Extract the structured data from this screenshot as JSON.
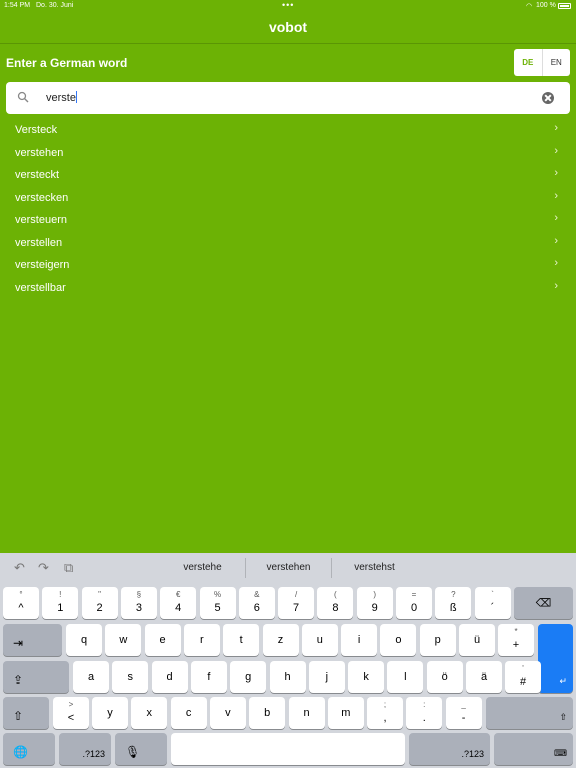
{
  "status": {
    "time": "1:54 PM",
    "date": "Do. 30. Juni",
    "dots": "•••",
    "wifi": "◠",
    "battery": "100 %"
  },
  "nav": {
    "title": "vobot"
  },
  "prompt": "Enter a German word",
  "language": {
    "options": [
      "DE",
      "EN"
    ],
    "selected": "DE"
  },
  "search": {
    "value": "verste"
  },
  "results": [
    "Versteck",
    "verstehen",
    "versteckt",
    "verstecken",
    "versteuern",
    "verstellen",
    "versteigern",
    "verstellbar"
  ],
  "keyboard": {
    "suggestions": [
      "verstehe",
      "verstehen",
      "verstehst"
    ],
    "tools": [
      "↶",
      "↷",
      "⧉"
    ],
    "number_row": [
      {
        "top": "°",
        "bottom": "^"
      },
      {
        "top": "!",
        "bottom": "1"
      },
      {
        "top": "\"",
        "bottom": "2"
      },
      {
        "top": "§",
        "bottom": "3"
      },
      {
        "top": "€",
        "bottom": "4"
      },
      {
        "top": "%",
        "bottom": "5"
      },
      {
        "top": "&",
        "bottom": "6"
      },
      {
        "top": "/",
        "bottom": "7"
      },
      {
        "top": "(",
        "bottom": "8"
      },
      {
        "top": ")",
        "bottom": "9"
      },
      {
        "top": "=",
        "bottom": "0"
      },
      {
        "top": "?",
        "bottom": "ß"
      },
      {
        "top": "`",
        "bottom": "´"
      }
    ],
    "row_q": [
      "q",
      "w",
      "e",
      "r",
      "t",
      "z",
      "u",
      "i",
      "o",
      "p",
      "ü"
    ],
    "row_q_extra": {
      "top": "*",
      "bottom": "+"
    },
    "row_a": [
      "a",
      "s",
      "d",
      "f",
      "g",
      "h",
      "j",
      "k",
      "l",
      "ö",
      "ä"
    ],
    "row_a_extra": {
      "top": "'",
      "bottom": "#"
    },
    "row_y_pre": {
      "top": ">",
      "bottom": "<"
    },
    "row_y": [
      "y",
      "x",
      "c",
      "v",
      "b",
      "n",
      "m"
    ],
    "row_y_punct": [
      {
        "top": ";",
        "bottom": ","
      },
      {
        "top": ":",
        "bottom": "."
      },
      {
        "top": "_",
        "bottom": "-"
      }
    ],
    "labels": {
      "delete": "⌫",
      "tab": "⇥",
      "caps": "⇪",
      "return": "↵",
      "shift": "⇧",
      "globe": "🌐",
      "num_left": ".?123",
      "mic": "🎙",
      "num_right": ".?123",
      "hide": "⌨"
    }
  }
}
